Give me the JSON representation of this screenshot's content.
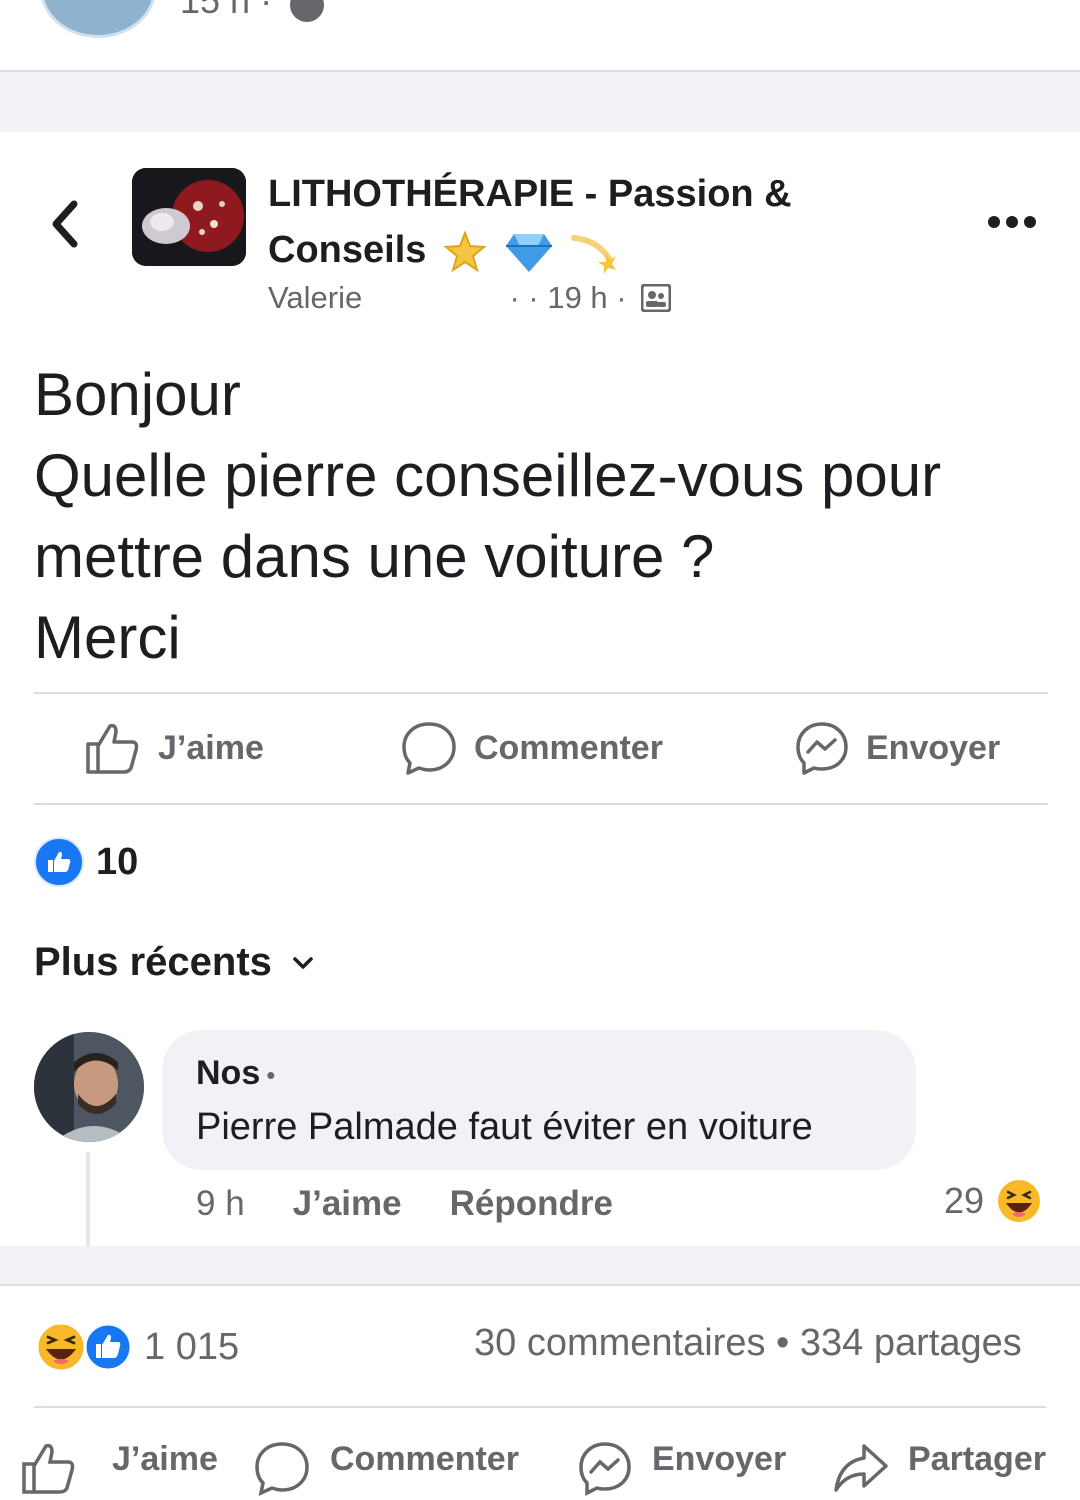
{
  "top_post": {
    "time": "15 h ·"
  },
  "group": {
    "name": "LITHOTHÉRAPIE - Passion & Conseils",
    "author": "Valerie",
    "time": "· · 19 h ·"
  },
  "post": {
    "lines": [
      "Bonjour",
      "Quelle pierre conseillez-vous pour",
      "mettre dans une voiture ?",
      "Merci"
    ]
  },
  "actions": {
    "like": "J’aime",
    "comment": "Commenter",
    "send": "Envoyer"
  },
  "likes": {
    "count": "10"
  },
  "sort": {
    "label": "Plus récents"
  },
  "comment": {
    "author": "Nos",
    "text": "Pierre Palmade faut éviter en voiture",
    "time": "9 h",
    "like": "J’aime",
    "reply": "Répondre",
    "reactions": "29"
  },
  "summary": {
    "reactions": "1 015",
    "comments_shares": "30 commentaires • 334 partages"
  },
  "bottom_actions": {
    "like": "J’aime",
    "comment": "Commenter",
    "send": "Envoyer",
    "share": "Partager"
  },
  "colors": {
    "accent": "#1877f2",
    "text": "#1c1e21",
    "muted": "#65676b",
    "haha": "#f7b928"
  }
}
